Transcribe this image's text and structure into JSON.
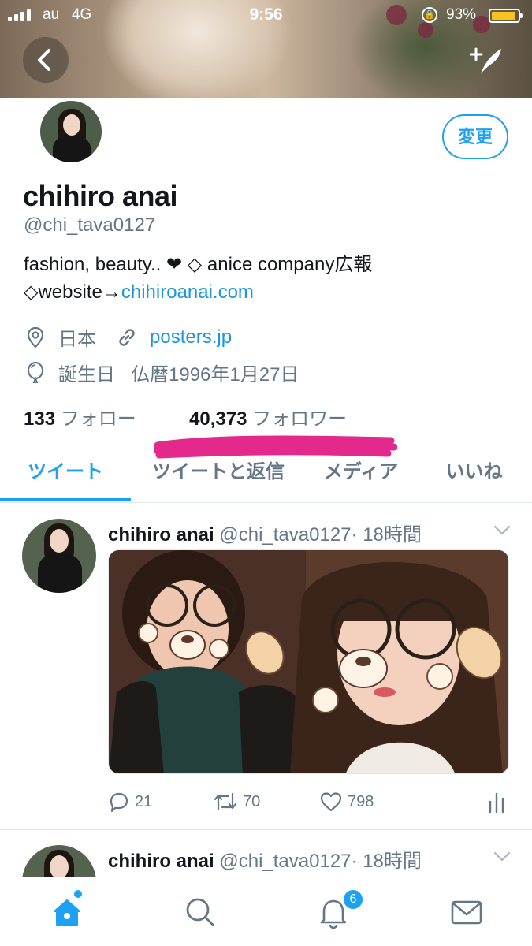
{
  "status_bar": {
    "carrier": "au",
    "network": "4G",
    "time": "9:56",
    "battery_percent": "93%",
    "battery_level": 0.93
  },
  "profile": {
    "display_name": "chihiro anai",
    "handle": "@chi_tava0127",
    "edit_label": "変更",
    "bio_line1": "fashion, beauty.. ❤ ◇ anice company広報",
    "bio_line2_prefix": "◇website→",
    "bio_link": "chihiroanai.com",
    "location": "日本",
    "website": "posters.jp",
    "birthday_label": "誕生日",
    "birthday_value": "仏暦1996年1月27日",
    "following_count": "133",
    "following_label": "フォロー",
    "followers_count": "40,373",
    "followers_label": "フォロワー"
  },
  "tabs": [
    {
      "label": "ツイート",
      "active": true
    },
    {
      "label": "ツイートと返信",
      "active": false
    },
    {
      "label": "メディア",
      "active": false
    },
    {
      "label": "いいね",
      "active": false
    }
  ],
  "tweets": [
    {
      "name": "chihiro anai",
      "handle": "@chi_tava0127",
      "time": "· 18時間",
      "replies": "21",
      "retweets": "70",
      "likes": "798"
    },
    {
      "name": "chihiro anai",
      "handle": "@chi_tava0127",
      "time": "· 18時間"
    }
  ],
  "bottom_nav": {
    "notifications_badge": "6"
  },
  "colors": {
    "accent": "#1da1f2",
    "link": "#1b95e0",
    "muted": "#657786",
    "scribble": "#e0127f"
  },
  "icons": [
    "back-arrow-icon",
    "compose-icon",
    "location-pin-icon",
    "link-icon",
    "balloon-icon",
    "chevron-down-icon",
    "reply-icon",
    "retweet-icon",
    "like-icon",
    "analytics-icon",
    "home-icon",
    "search-icon",
    "notifications-icon",
    "messages-icon"
  ]
}
